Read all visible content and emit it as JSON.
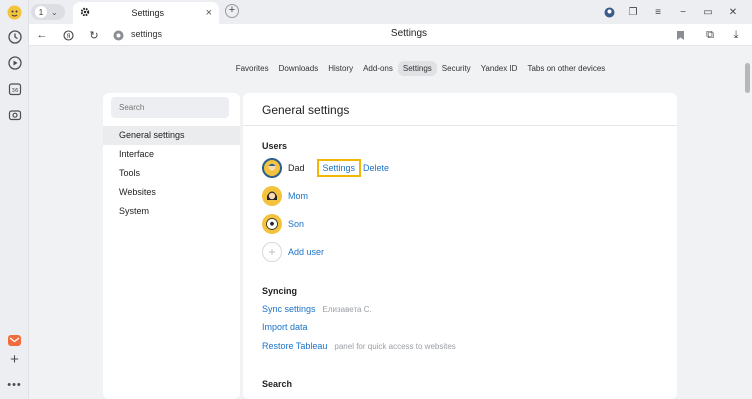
{
  "tab": {
    "title": "Settings",
    "count": "1"
  },
  "address": {
    "url": "settings",
    "page_title": "Settings"
  },
  "topnav": [
    "Favorites",
    "Downloads",
    "History",
    "Add-ons",
    "Settings",
    "Security",
    "Yandex ID",
    "Tabs on other devices"
  ],
  "topnav_active": "Settings",
  "sidebar": {
    "search_placeholder": "Search",
    "items": [
      "General settings",
      "Interface",
      "Tools",
      "Websites",
      "System"
    ]
  },
  "main": {
    "title": "General settings",
    "users_heading": "Users",
    "users": [
      {
        "name": "Dad",
        "settings_label": "Settings",
        "delete_label": "Delete"
      },
      {
        "name": "Mom"
      },
      {
        "name": "Son"
      }
    ],
    "add_user_label": "Add user",
    "syncing_heading": "Syncing",
    "sync_settings_label": "Sync settings",
    "sync_account": "Елизавета С.",
    "import_data_label": "Import data",
    "restore_tableau_label": "Restore Tableau",
    "restore_tableau_desc": "panel for quick access to websites",
    "search_heading": "Search"
  },
  "colors": {
    "link": "#1a73c9",
    "highlight": "#f2b705",
    "avatar": "#f3c33d"
  }
}
